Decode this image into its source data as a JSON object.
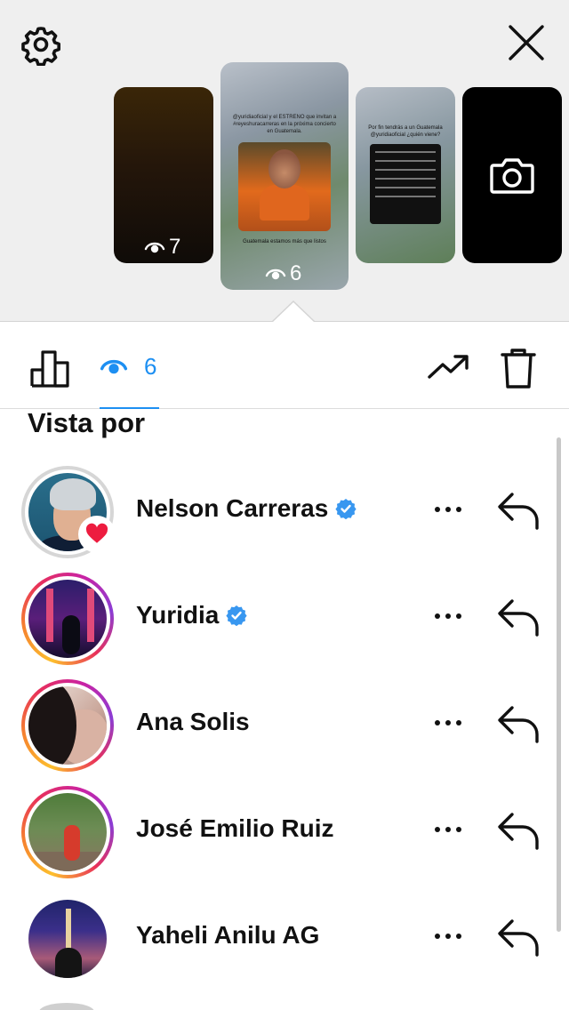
{
  "header": {
    "settings_icon": "gear-icon",
    "close_icon": "close-icon"
  },
  "stories": [
    {
      "views": "7",
      "style": "dark"
    },
    {
      "views": "6",
      "style": "selected",
      "caption_top": "@yuridiaoficial y el ESTRENO que invitan a #reyeshuracarreras en la próxima concierto en Guatemala.",
      "card_text": "acosanelsonc y nelsonc...",
      "caption_bottom": "Guatemala estamos más que listos"
    },
    {
      "views": "",
      "style": "concert",
      "caption_top": "Por fin tendrás a un Guatemala @yuridiaoficial ¿quién viene?"
    },
    {
      "views": "",
      "style": "camera",
      "icon": "camera-icon"
    }
  ],
  "toolbar": {
    "chart_icon": "bar-chart-icon",
    "views_count": "6",
    "trend_icon": "trending-up-icon",
    "trash_icon": "trash-icon"
  },
  "list": {
    "title": "Vista por",
    "viewers": [
      {
        "name": "Nelson Carreras",
        "verified": true,
        "liked": true,
        "ring": "plain"
      },
      {
        "name": "Yuridia",
        "verified": true,
        "liked": false,
        "ring": "story"
      },
      {
        "name": "Ana Solis",
        "verified": false,
        "liked": false,
        "ring": "story"
      },
      {
        "name": "José Emilio Ruiz",
        "verified": false,
        "liked": false,
        "ring": "story"
      },
      {
        "name": "Yaheli Anilu AG",
        "verified": false,
        "liked": false,
        "ring": "none"
      }
    ]
  },
  "colors": {
    "accent_blue": "#1d8ff2",
    "heart_red": "#ed1c3f",
    "verified_blue": "#3897f0"
  }
}
